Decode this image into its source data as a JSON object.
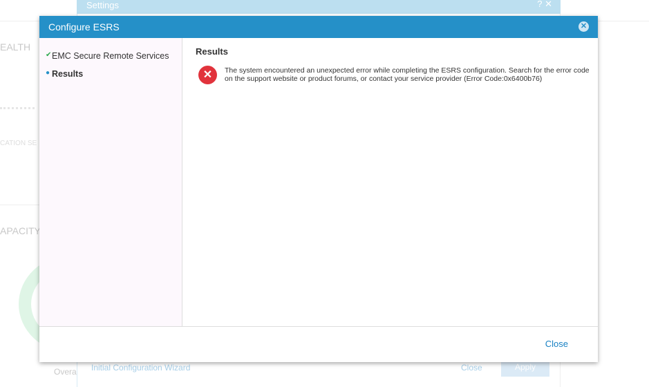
{
  "background": {
    "settings_title": "Settings",
    "health_label": "EALTH",
    "replication_label": "CATION SE",
    "capacity_label": "APACITY",
    "overall_label": "Overa",
    "wizard_link": "Initial Configuration Wizard",
    "close_label": "Close",
    "apply_label": "Apply"
  },
  "dialog": {
    "title": "Configure ESRS",
    "steps": [
      {
        "label": "EMC Secure Remote Services",
        "status": "done"
      },
      {
        "label": "Results",
        "status": "current"
      }
    ],
    "section_title": "Results",
    "error_message": "The system encountered an unexpected error while completing the ESRS configuration. Search for the error code on the support website or product forums, or contact your service provider (Error Code:0x6400b76)",
    "close_label": "Close"
  },
  "colors": {
    "header": "#2590c8",
    "error": "#e1333c",
    "link": "#1a82c4",
    "check": "#2aa84a"
  }
}
